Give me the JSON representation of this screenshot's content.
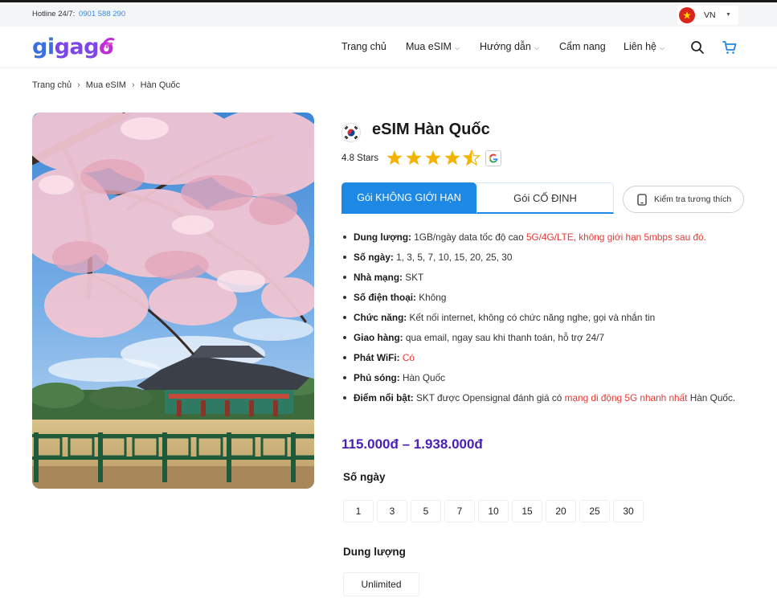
{
  "topbar": {
    "hotline_label": "Hotline 24/7:",
    "hotline_number": "0901 588 290",
    "language": "VN"
  },
  "header": {
    "logo_parts": [
      "gi",
      "ga",
      "g",
      "o"
    ],
    "nav": [
      {
        "label": "Trang chủ",
        "has_dropdown": false
      },
      {
        "label": "Mua eSIM",
        "has_dropdown": true
      },
      {
        "label": "Hướng dẫn",
        "has_dropdown": true
      },
      {
        "label": "Cẩm nang",
        "has_dropdown": false
      },
      {
        "label": "Liên hệ",
        "has_dropdown": true
      }
    ],
    "icons": [
      "search-icon",
      "cart-icon"
    ]
  },
  "breadcrumb": [
    "Trang chủ",
    "Mua eSIM",
    "Hàn Quốc"
  ],
  "product": {
    "title": "eSIM Hàn Quốc",
    "rating_text": "4.8 Stars",
    "rating": 4.8,
    "tabs": [
      {
        "label": "Gói KHÔNG GIỚI HẠN",
        "active": true
      },
      {
        "label": "Gói CỐ ĐỊNH",
        "active": false
      }
    ],
    "compat_button": "Kiểm tra tương thích",
    "features": [
      {
        "label": "Dung lượng:",
        "text": " 1GB/ngày data tốc độ cao ",
        "highlight": "5G/4G/LTE, không giới hạn 5mbps sau đó."
      },
      {
        "label": "Số ngày:",
        "text": " 1, 3, 5, 7, 10, 15, 20, 25, 30",
        "highlight": ""
      },
      {
        "label": "Nhà mạng:",
        "text": " SKT",
        "highlight": ""
      },
      {
        "label": "Số điện thoại:",
        "text": " Không",
        "highlight": ""
      },
      {
        "label": "Chức năng:",
        "text": " Kết nối internet, không có chức năng nghe, gọi và nhắn tin",
        "highlight": ""
      },
      {
        "label": "Giao hàng:",
        "text": " qua email, ngay sau khi thanh toán, hỗ trợ 24/7",
        "highlight": ""
      },
      {
        "label": "Phát WiFi:",
        "text": " ",
        "highlight": "Có"
      },
      {
        "label": "Phủ sóng:",
        "text": " Hàn Quốc",
        "highlight": ""
      },
      {
        "label": "Điểm nổi bật:",
        "text": " SKT được Opensignal đánh giá có ",
        "highlight": "mạng di động 5G nhanh nhất",
        "tail": " Hàn Quốc."
      }
    ],
    "price_range": "115.000đ – 1.938.000đ",
    "days_label": "Số ngày",
    "days": [
      "1",
      "3",
      "5",
      "7",
      "10",
      "15",
      "20",
      "25",
      "30"
    ],
    "data_label": "Dung lượng",
    "data_options": [
      "Unlimited"
    ]
  },
  "colors": {
    "accent_blue": "#1e88e5",
    "price_purple": "#4a1fb8",
    "highlight_red": "#e53935",
    "star_yellow": "#f5b301",
    "hotline_blue": "#3a8be0"
  }
}
